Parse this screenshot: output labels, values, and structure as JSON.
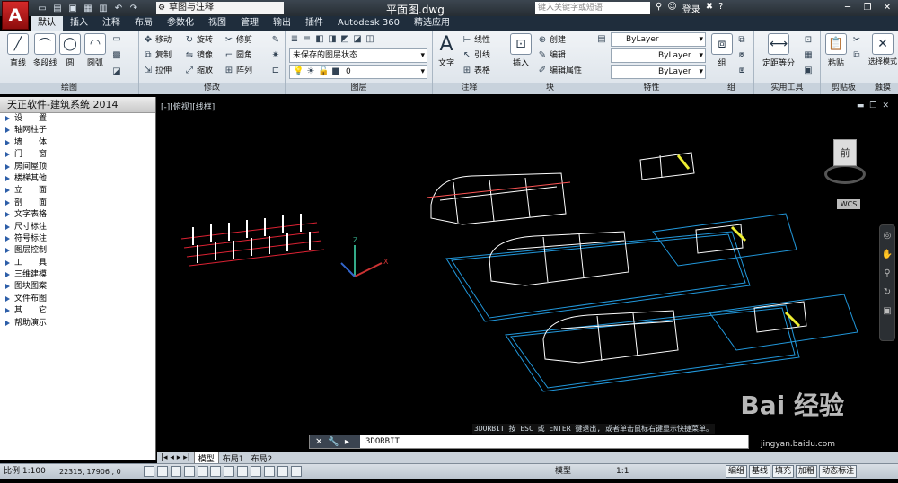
{
  "title_bar": {
    "workspace": "草图与注释",
    "document_title": "平面图.dwg",
    "search_placeholder": "键入关键字或短语",
    "login_label": "登录"
  },
  "ribbon_tabs": [
    "默认",
    "插入",
    "注释",
    "布局",
    "参数化",
    "视图",
    "管理",
    "输出",
    "插件",
    "Autodesk 360",
    "精选应用"
  ],
  "ribbon_active_tab": "默认",
  "ribbon": {
    "draw": {
      "title": "绘图",
      "line": "直线",
      "polyline": "多段线",
      "circle": "圆",
      "arc": "圆弧"
    },
    "modify": {
      "title": "修改",
      "move": "移动",
      "rotate": "旋转",
      "trim": "修剪",
      "copy": "复制",
      "mirror": "镜像",
      "fillet": "圆角",
      "stretch": "拉伸",
      "scale": "缩放",
      "array": "阵列"
    },
    "layers": {
      "title": "图层",
      "state": "未保存的图层状态",
      "current": "0"
    },
    "annotation": {
      "title": "注释",
      "text": "文字",
      "linear": "线性",
      "leader": "引线",
      "table": "表格"
    },
    "block": {
      "title": "块",
      "insert": "插入",
      "create": "创建",
      "edit": "编辑",
      "edit_attr": "编辑属性"
    },
    "properties": {
      "title": "特性",
      "color": "ByLayer",
      "linetype": "ByLayer",
      "lineweight": "ByLayer"
    },
    "groups": {
      "title": "组",
      "group": "组"
    },
    "utilities": {
      "title": "实用工具",
      "measure": "定距等分"
    },
    "clipboard": {
      "title": "剪贴板",
      "paste": "粘贴"
    },
    "touch": {
      "title": "触摸",
      "select_mode": "选择模式"
    }
  },
  "sidebar": {
    "title": "天正软件-建筑系统 2014",
    "items": [
      "设　　置",
      "轴网柱子",
      "墙　　体",
      "门　　窗",
      "房间屋顶",
      "楼梯其他",
      "立　　面",
      "剖　　面",
      "文字表格",
      "尺寸标注",
      "符号标注",
      "图层控制",
      "工　　具",
      "三维建模",
      "图块图案",
      "文件布图",
      "其　　它",
      "帮助演示"
    ]
  },
  "viewport": {
    "label": "[-][俯视][线框]",
    "viewcube_face": "前",
    "wcs": "WCS"
  },
  "command": {
    "current": "3DORBIT",
    "hint": "3DORBIT 按 ESC 或 ENTER 键退出, 或者单击鼠标右键显示快捷菜单。"
  },
  "layout_tabs": [
    "模型",
    "布局1",
    "布局2"
  ],
  "status_bar": {
    "scale": "比例 1:100",
    "coords": "22315, 17906 , 0",
    "model": "模型",
    "anno_scale": "1:1",
    "buttons": [
      "编组",
      "基线",
      "填充",
      "加粗",
      "动态标注"
    ]
  },
  "watermark": {
    "brand": "Bai 经验",
    "url": "jingyan.baidu.com"
  }
}
